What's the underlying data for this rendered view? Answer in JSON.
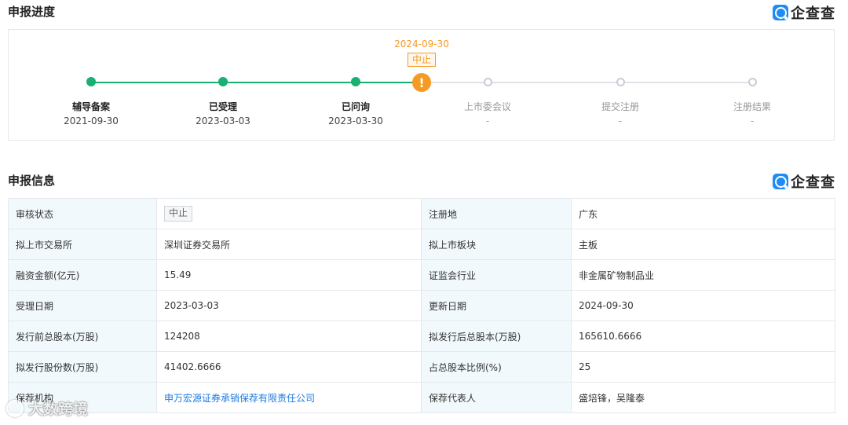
{
  "brand": {
    "name": "企查查",
    "accent": "#1f8cf3"
  },
  "progress": {
    "title": "申报进度",
    "status_date": "2024-09-30",
    "status_tag": "中止",
    "colors": {
      "done": "#1ab072",
      "warn": "#f59a23",
      "todo": "#c9cdd4"
    },
    "steps": [
      {
        "label": "辅导备案",
        "date": "2021-09-30",
        "state": "done"
      },
      {
        "label": "已受理",
        "date": "2023-03-03",
        "state": "done"
      },
      {
        "label": "已问询",
        "date": "2023-03-30",
        "state": "done"
      },
      {
        "label": "上市委会议",
        "date": "-",
        "state": "todo"
      },
      {
        "label": "提交注册",
        "date": "-",
        "state": "todo"
      },
      {
        "label": "注册结果",
        "date": "-",
        "state": "todo"
      }
    ]
  },
  "info": {
    "title": "申报信息",
    "rows": [
      {
        "k1": "审核状态",
        "v1": "中止",
        "k2": "注册地",
        "v2": "广东"
      },
      {
        "k1": "拟上市交易所",
        "v1": "深圳证券交易所",
        "k2": "拟上市板块",
        "v2": "主板"
      },
      {
        "k1": "融资金额(亿元)",
        "v1": "15.49",
        "k2": "证监会行业",
        "v2": "非金属矿物制品业"
      },
      {
        "k1": "受理日期",
        "v1": "2023-03-03",
        "k2": "更新日期",
        "v2": "2024-09-30"
      },
      {
        "k1": "发行前总股本(万股)",
        "v1": "124208",
        "k2": "拟发行后总股本(万股)",
        "v2": "165610.6666"
      },
      {
        "k1": "拟发行股份数(万股)",
        "v1": "41402.6666",
        "k2": "占总股本比例(%)",
        "v2": "25"
      },
      {
        "k1": "保荐机构",
        "v1": "申万宏源证券承销保荐有限责任公司",
        "k2": "保荐代表人",
        "v2": "盛培锋，吴隆泰"
      }
    ]
  },
  "watermark": {
    "text": "大数跨境"
  }
}
